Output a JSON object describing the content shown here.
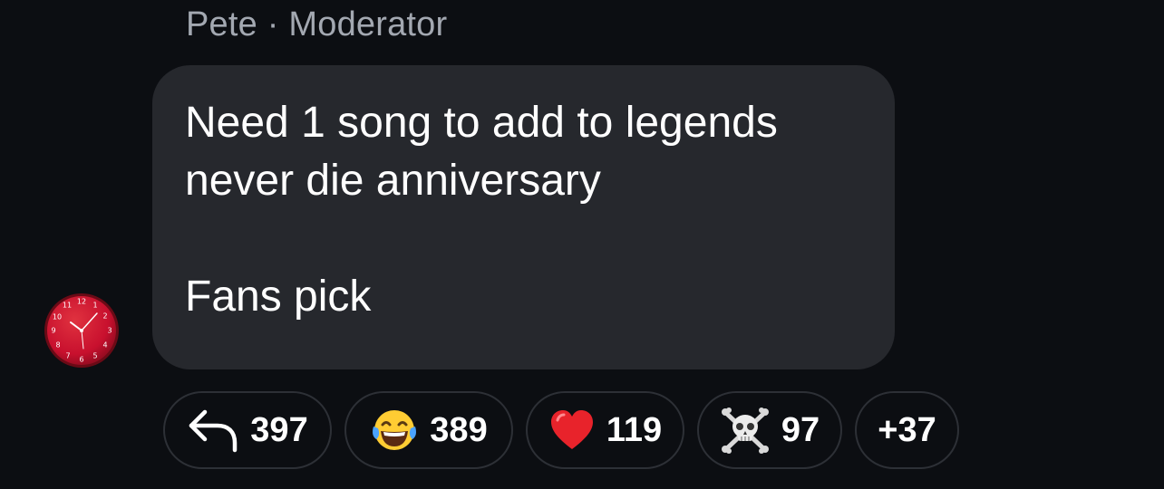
{
  "message": {
    "sender_name": "Pete",
    "separator": "·",
    "sender_role": "Moderator",
    "text": "Need 1 song to add to legends never die anniversary\n\nFans pick"
  },
  "avatar": {
    "icon": "red-wall-clock-icon",
    "color": "#c8102e"
  },
  "reactions": [
    {
      "icon": "reply-arrow-icon",
      "count": "397"
    },
    {
      "icon": "tears-of-joy-emoji-icon",
      "count": "389"
    },
    {
      "icon": "red-heart-emoji-icon",
      "count": "119"
    },
    {
      "icon": "skull-crossbones-emoji-icon",
      "count": "97"
    }
  ],
  "more_reactions": "+37",
  "colors": {
    "background": "#0c0e12",
    "bubble": "#26282d",
    "muted_text": "#a3a8b1",
    "chip_border": "#2d3036"
  }
}
